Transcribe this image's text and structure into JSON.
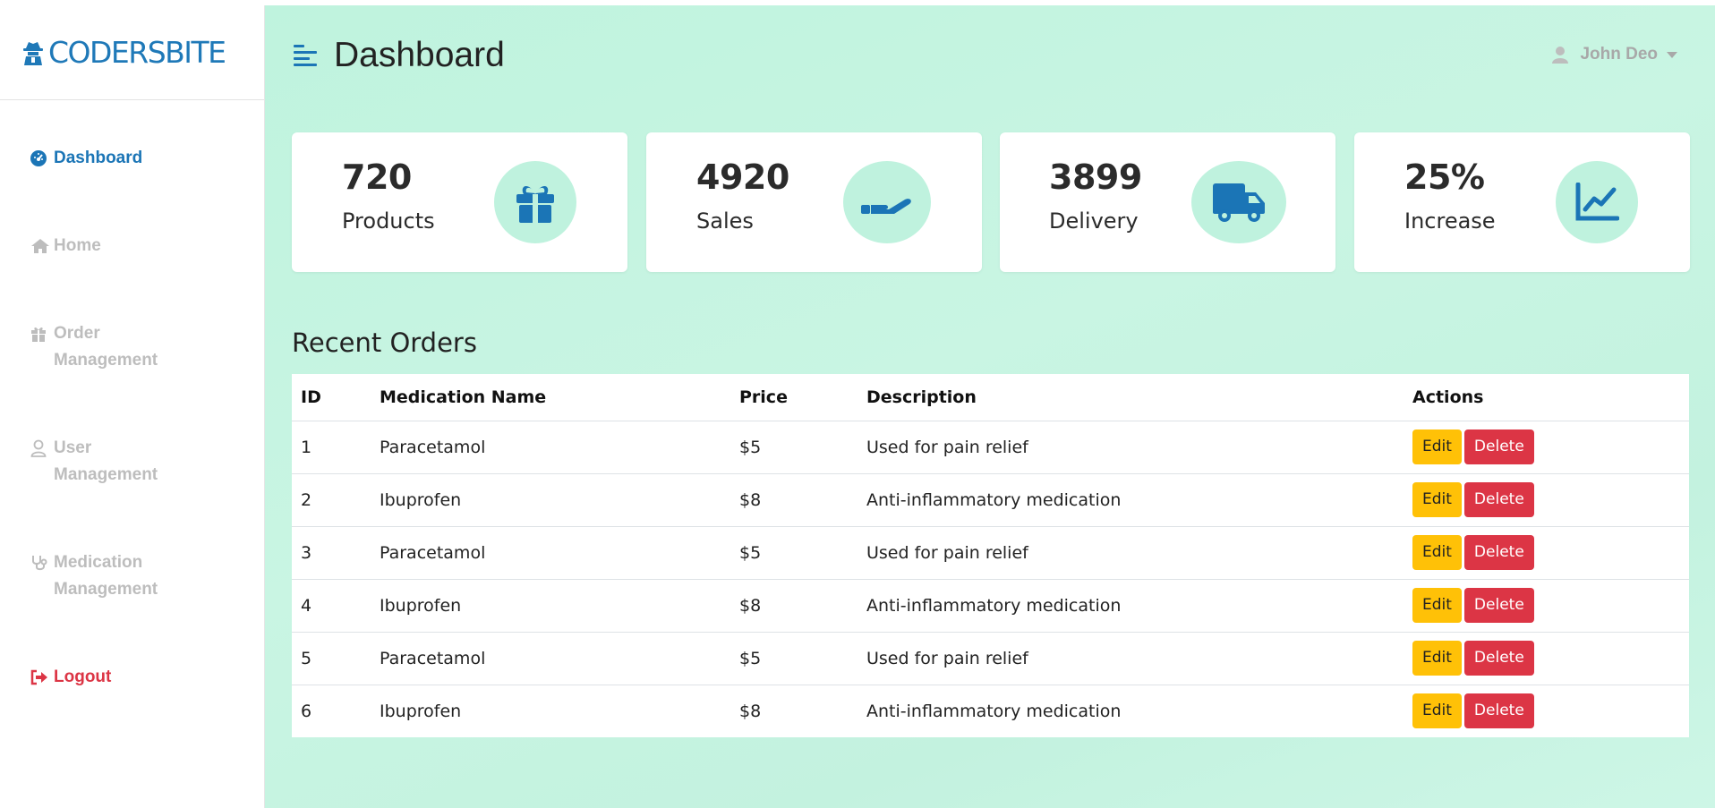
{
  "brand": {
    "name": "CODERSBITE"
  },
  "sidebar": {
    "items": [
      {
        "label": "Dashboard",
        "icon": "dashboard-gauge-icon",
        "active": true
      },
      {
        "label": "Home",
        "icon": "home-icon"
      },
      {
        "label": "Order Management",
        "icon": "gift-icon"
      },
      {
        "label": "User Management",
        "icon": "user-icon"
      },
      {
        "label": "Medication Management",
        "icon": "stethoscope-icon"
      }
    ],
    "logout": {
      "label": "Logout",
      "icon": "sign-out-icon"
    }
  },
  "header": {
    "title": "Dashboard",
    "user_name": "John Deo"
  },
  "cards": [
    {
      "value": "720",
      "label": "Products",
      "icon": "gift-icon"
    },
    {
      "value": "4920",
      "label": "Sales",
      "icon": "hand-holding-icon"
    },
    {
      "value": "3899",
      "label": "Delivery",
      "icon": "truck-icon"
    },
    {
      "value": "25%",
      "label": "Increase",
      "icon": "chart-line-icon"
    }
  ],
  "orders": {
    "title": "Recent Orders",
    "columns": [
      "ID",
      "Medication Name",
      "Price",
      "Description",
      "Actions"
    ],
    "rows": [
      {
        "id": "1",
        "name": "Paracetamol",
        "price": "$5",
        "description": "Used for pain relief"
      },
      {
        "id": "2",
        "name": "Ibuprofen",
        "price": "$8",
        "description": "Anti-inflammatory medication"
      },
      {
        "id": "3",
        "name": "Paracetamol",
        "price": "$5",
        "description": "Used for pain relief"
      },
      {
        "id": "4",
        "name": "Ibuprofen",
        "price": "$8",
        "description": "Anti-inflammatory medication"
      },
      {
        "id": "5",
        "name": "Paracetamol",
        "price": "$5",
        "description": "Used for pain relief"
      },
      {
        "id": "6",
        "name": "Ibuprofen",
        "price": "$8",
        "description": "Anti-inflammatory medication"
      }
    ],
    "edit_label": "Edit",
    "delete_label": "Delete"
  },
  "colors": {
    "accent": "#1b75b6",
    "background": "#c3f2df",
    "icon_circle": "#bff2de",
    "edit": "#ffc107",
    "delete": "#dc3545"
  }
}
